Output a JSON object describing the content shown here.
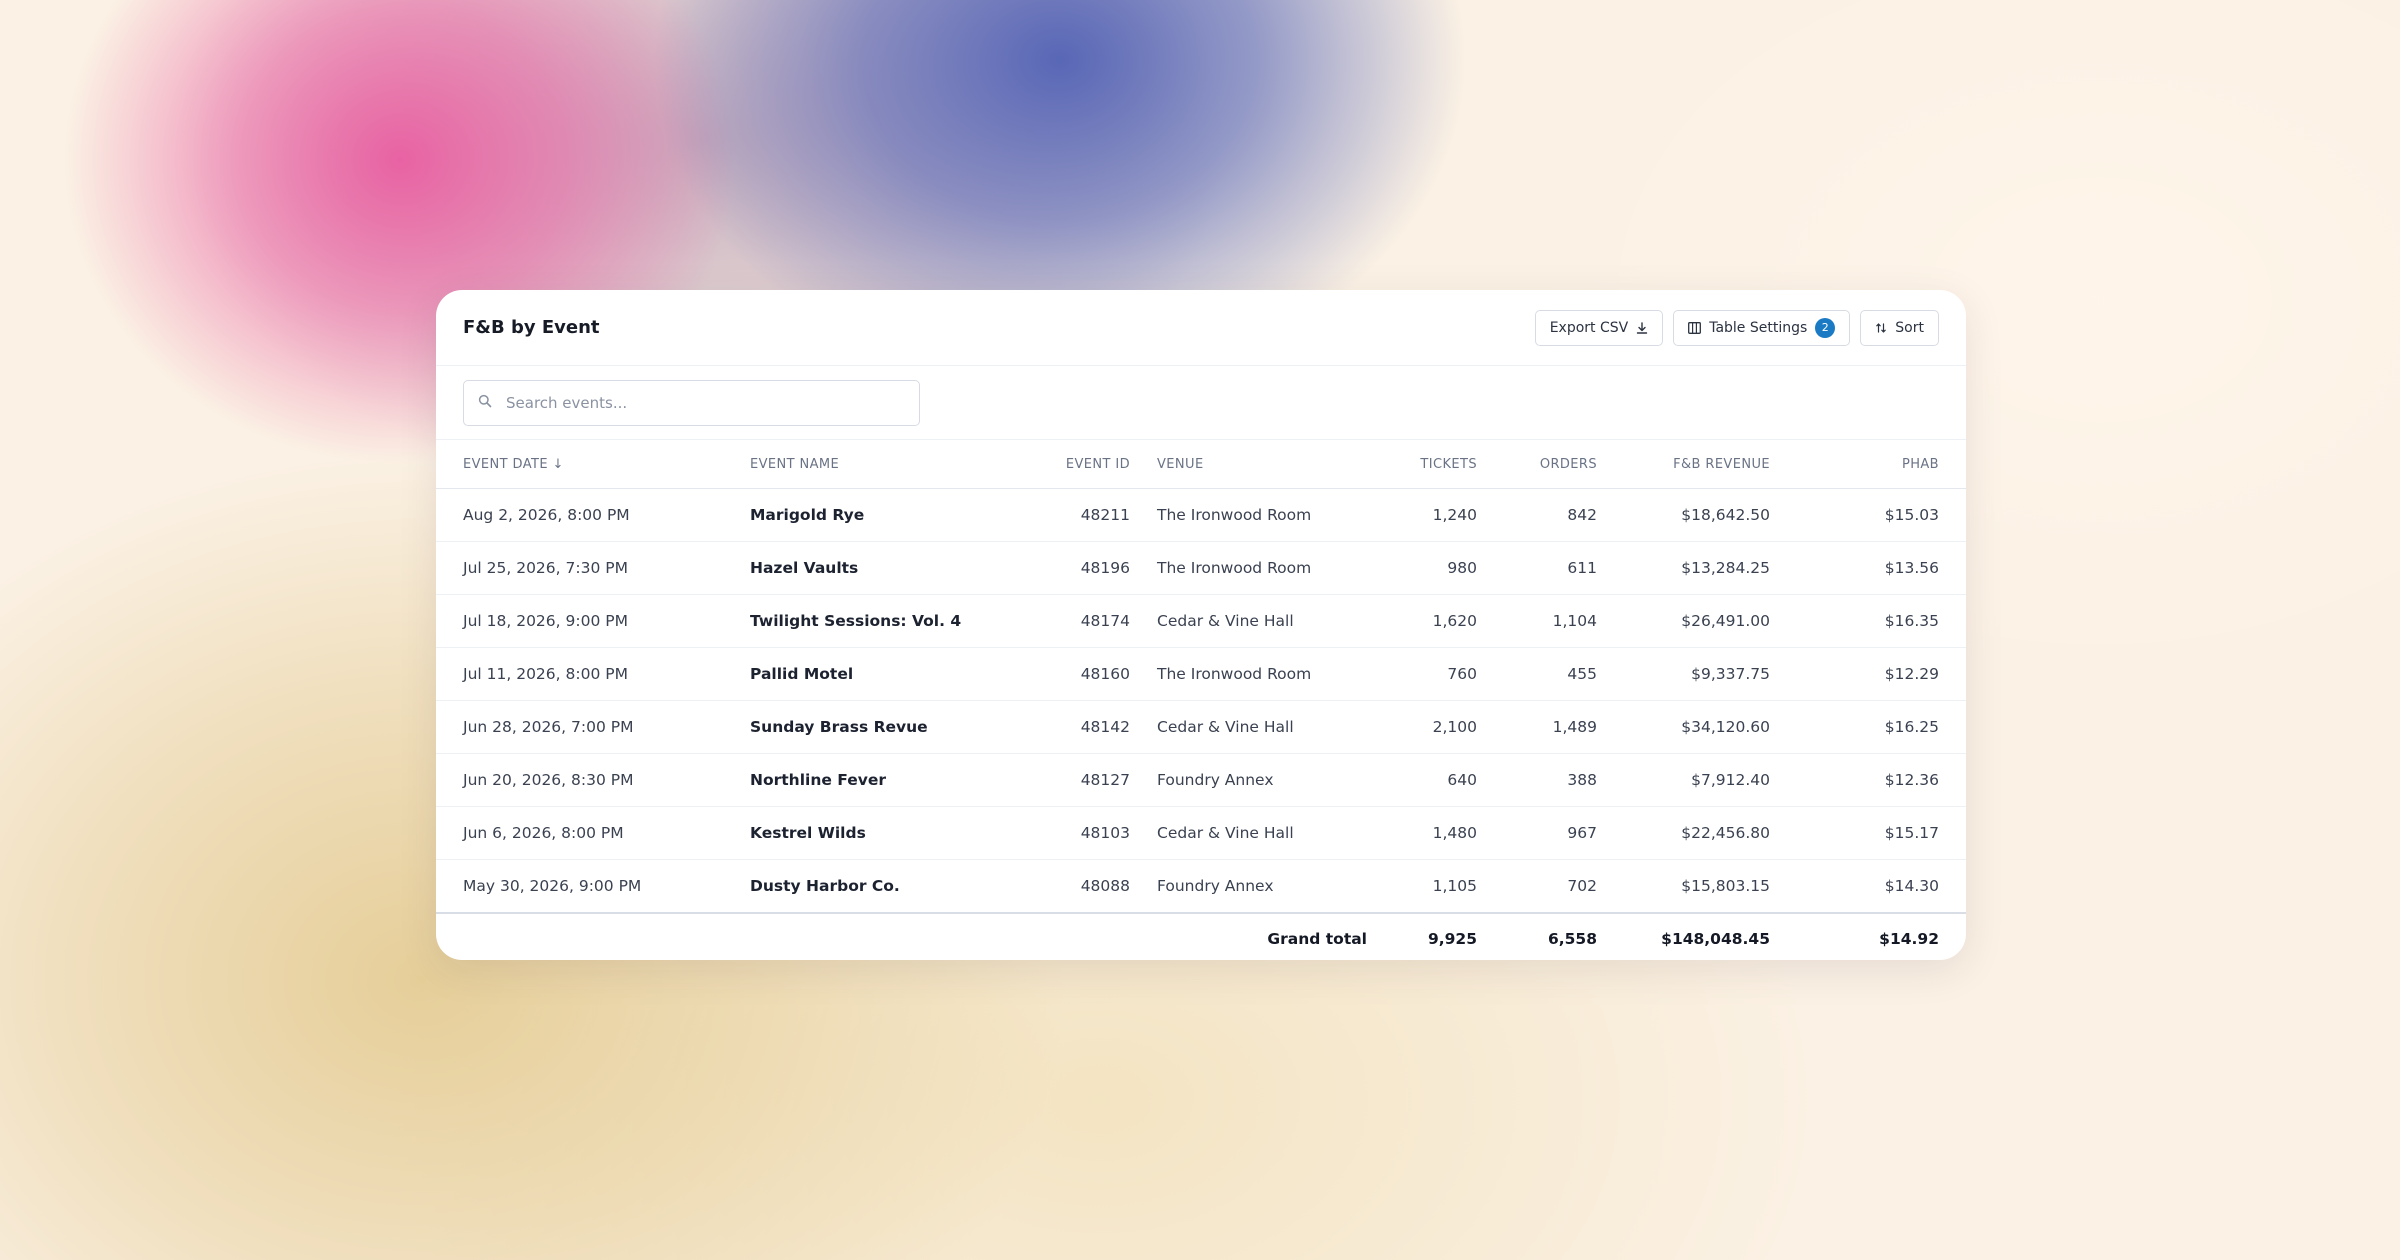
{
  "header": {
    "title": "F&B by Event",
    "export_label": "Export CSV",
    "table_settings_label": "Table Settings",
    "table_settings_count": "2",
    "sort_label": "Sort"
  },
  "search": {
    "placeholder": "Search events...",
    "value": ""
  },
  "columns": {
    "event_date": "EVENT DATE ↓",
    "event_name": "EVENT NAME",
    "event_id": "EVENT ID",
    "venue": "VENUE",
    "tickets": "TICKETS",
    "orders": "ORDERS",
    "fb_revenue": "F&B REVENUE",
    "phab": "PHAB"
  },
  "rows": [
    {
      "date": "Aug 2, 2026, 8:00 PM",
      "name": "Marigold Rye",
      "id": "48211",
      "venue": "The Ironwood Room",
      "tickets": "1,240",
      "orders": "842",
      "revenue": "$18,642.50",
      "phab": "$15.03"
    },
    {
      "date": "Jul 25, 2026, 7:30 PM",
      "name": "Hazel Vaults",
      "id": "48196",
      "venue": "The Ironwood Room",
      "tickets": "980",
      "orders": "611",
      "revenue": "$13,284.25",
      "phab": "$13.56"
    },
    {
      "date": "Jul 18, 2026, 9:00 PM",
      "name": "Twilight Sessions: Vol. 4",
      "id": "48174",
      "venue": "Cedar & Vine Hall",
      "tickets": "1,620",
      "orders": "1,104",
      "revenue": "$26,491.00",
      "phab": "$16.35"
    },
    {
      "date": "Jul 11, 2026, 8:00 PM",
      "name": "Pallid Motel",
      "id": "48160",
      "venue": "The Ironwood Room",
      "tickets": "760",
      "orders": "455",
      "revenue": "$9,337.75",
      "phab": "$12.29"
    },
    {
      "date": "Jun 28, 2026, 7:00 PM",
      "name": "Sunday Brass Revue",
      "id": "48142",
      "venue": "Cedar & Vine Hall",
      "tickets": "2,100",
      "orders": "1,489",
      "revenue": "$34,120.60",
      "phab": "$16.25"
    },
    {
      "date": "Jun 20, 2026, 8:30 PM",
      "name": "Northline Fever",
      "id": "48127",
      "venue": "Foundry Annex",
      "tickets": "640",
      "orders": "388",
      "revenue": "$7,912.40",
      "phab": "$12.36"
    },
    {
      "date": "Jun 6, 2026, 8:00 PM",
      "name": "Kestrel Wilds",
      "id": "48103",
      "venue": "Cedar & Vine Hall",
      "tickets": "1,480",
      "orders": "967",
      "revenue": "$22,456.80",
      "phab": "$15.17"
    },
    {
      "date": "May 30, 2026, 9:00 PM",
      "name": "Dusty Harbor Co.",
      "id": "48088",
      "venue": "Foundry Annex",
      "tickets": "1,105",
      "orders": "702",
      "revenue": "$15,803.15",
      "phab": "$14.30"
    }
  ],
  "totals": {
    "label": "Grand total",
    "tickets": "9,925",
    "orders": "6,558",
    "revenue": "$148,048.45",
    "phab": "$14.92"
  },
  "icons": {
    "export": "download-icon",
    "table_settings": "columns-icon",
    "sort": "sort-icon",
    "search": "search-icon"
  },
  "colors": {
    "badge": "#1a7bc4",
    "card_bg": "#ffffff"
  }
}
